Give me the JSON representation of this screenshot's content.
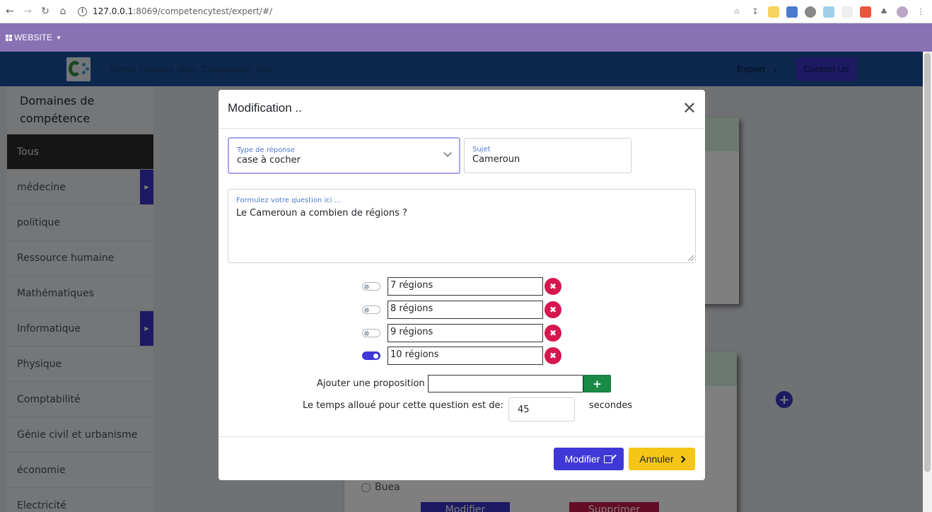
{
  "browser": {
    "url_host": "127.0.0.1",
    "url_path": ":8069/competencytest/expert/#/"
  },
  "website_bar": {
    "label": "WEBSITE"
  },
  "navbar": {
    "links": [
      "Home",
      "Courses",
      "Jobs",
      "Competency Test"
    ],
    "expert_label": "Expert",
    "contact_label": "Contact Us"
  },
  "sidebar": {
    "title": "Domaines de compétence",
    "items": [
      {
        "label": "Tous",
        "active": true,
        "submenu": false
      },
      {
        "label": "médecine",
        "active": false,
        "submenu": true
      },
      {
        "label": "politique",
        "active": false,
        "submenu": false
      },
      {
        "label": "Ressource humaine",
        "active": false,
        "submenu": false
      },
      {
        "label": "Mathématiques",
        "active": false,
        "submenu": false
      },
      {
        "label": "Informatique",
        "active": false,
        "submenu": true
      },
      {
        "label": "Physique",
        "active": false,
        "submenu": false
      },
      {
        "label": "Comptabilité",
        "active": false,
        "submenu": false
      },
      {
        "label": "Génie civil et urbanisme",
        "active": false,
        "submenu": false
      },
      {
        "label": "économie",
        "active": false,
        "submenu": false
      },
      {
        "label": "Electricité",
        "active": false,
        "submenu": false
      }
    ]
  },
  "background": {
    "option_label": "Buea",
    "modify_label": "Modifier",
    "delete_label": "Supprimer"
  },
  "modal": {
    "title": "Modification ..",
    "response_type": {
      "label": "Type de réponse",
      "value": "case à cocher"
    },
    "subject": {
      "label": "Sujet",
      "value": "Cameroun"
    },
    "question": {
      "placeholder": "Formulez votre question ici ...",
      "value": "Le Cameroun a combien de régions ?"
    },
    "options": [
      {
        "text": "7 régions",
        "checked": false
      },
      {
        "text": "8 régions",
        "checked": false
      },
      {
        "text": "9 régions",
        "checked": false
      },
      {
        "text": "10 régions",
        "checked": true
      }
    ],
    "add_label": "Ajouter une proposition",
    "add_value": "",
    "time_label": "Le temps alloué pour cette question est de:",
    "time_value": "45",
    "time_unit": "secondes",
    "modify_button": "Modifier",
    "cancel_button": "Annuler"
  },
  "colors": {
    "primary": "#3f37d6",
    "danger": "#d6174d",
    "warning": "#f5c518",
    "success": "#1a8a45",
    "website_bar": "#8872b4",
    "navbar": "#1b4f9b"
  }
}
